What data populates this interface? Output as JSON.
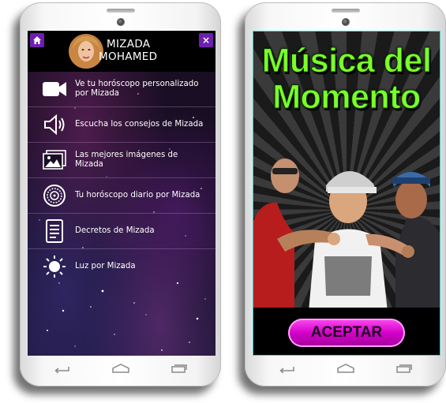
{
  "left_app": {
    "brand_line1": "MIZADA",
    "brand_line2": "MOHAMED",
    "close_glyph": "×",
    "menu": [
      {
        "label": "Ve tu horóscopo personalizado por Mizada",
        "icon": "video-camera-icon"
      },
      {
        "label": "Escucha los consejos de Mizada",
        "icon": "speaker-icon"
      },
      {
        "label": "Las mejores imágenes de Mizada",
        "icon": "images-icon"
      },
      {
        "label": "Tu horóscopo diario por Mizada",
        "icon": "zodiac-wheel-icon"
      },
      {
        "label": "Decretos de Mizada",
        "icon": "document-icon"
      },
      {
        "label": "Luz por Mizada",
        "icon": "sun-icon"
      }
    ]
  },
  "right_app": {
    "title_line1": "Música del",
    "title_line2": "Momento",
    "accept_label": "ACEPTAR"
  },
  "colors": {
    "accent_purple": "#6d1fb0",
    "title_green": "#7bff2a",
    "button_magenta": "#d400c8",
    "screen_border": "#3fd0cf"
  }
}
